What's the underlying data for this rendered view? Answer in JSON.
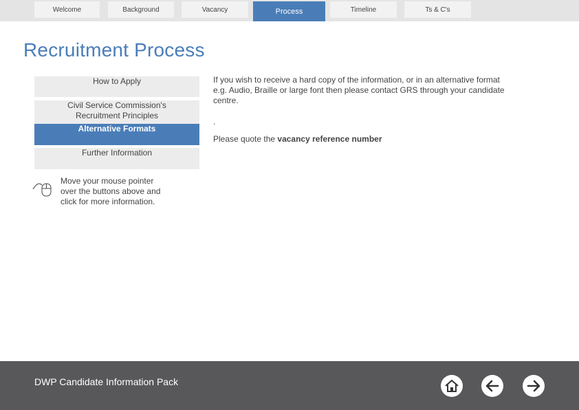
{
  "nav": {
    "tabs": [
      {
        "label": "Welcome"
      },
      {
        "label": "Background"
      },
      {
        "label": "Vacancy"
      },
      {
        "label": "Process"
      },
      {
        "label": "Timeline"
      },
      {
        "label": "Ts & C's"
      }
    ],
    "active_tab": "Process"
  },
  "page": {
    "title": "Recruitment Process"
  },
  "menu": {
    "items": [
      {
        "label": "How to Apply"
      },
      {
        "label": "Civil Service Commission's Recruitment Principles"
      },
      {
        "label": "Alternative Formats"
      },
      {
        "label": "Further Information"
      }
    ],
    "active": "Alternative Formats"
  },
  "hint": {
    "icon": "mouse-icon",
    "text": "Move your mouse pointer over the buttons above and click for more information."
  },
  "content": {
    "paragraph1": "If you wish to receive a hard copy of the information, or in an alternative format e.g. Audio, Braille or large font then please contact GRS through your candidate centre.",
    "dot": ".",
    "quote_prefix": "Please quote the ",
    "quote_bold": "vacancy reference number"
  },
  "footer": {
    "title": "DWP Candidate Information Pack",
    "buttons": [
      {
        "icon": "home-icon"
      },
      {
        "icon": "arrow-left-icon"
      },
      {
        "icon": "arrow-right-icon"
      }
    ]
  },
  "colors": {
    "accent": "#4a7db8",
    "footer_bg": "#58585a",
    "tab_bg": "#f2f2f2",
    "topbar_bg": "#e4e4e4",
    "menu_bg": "#ececec"
  }
}
